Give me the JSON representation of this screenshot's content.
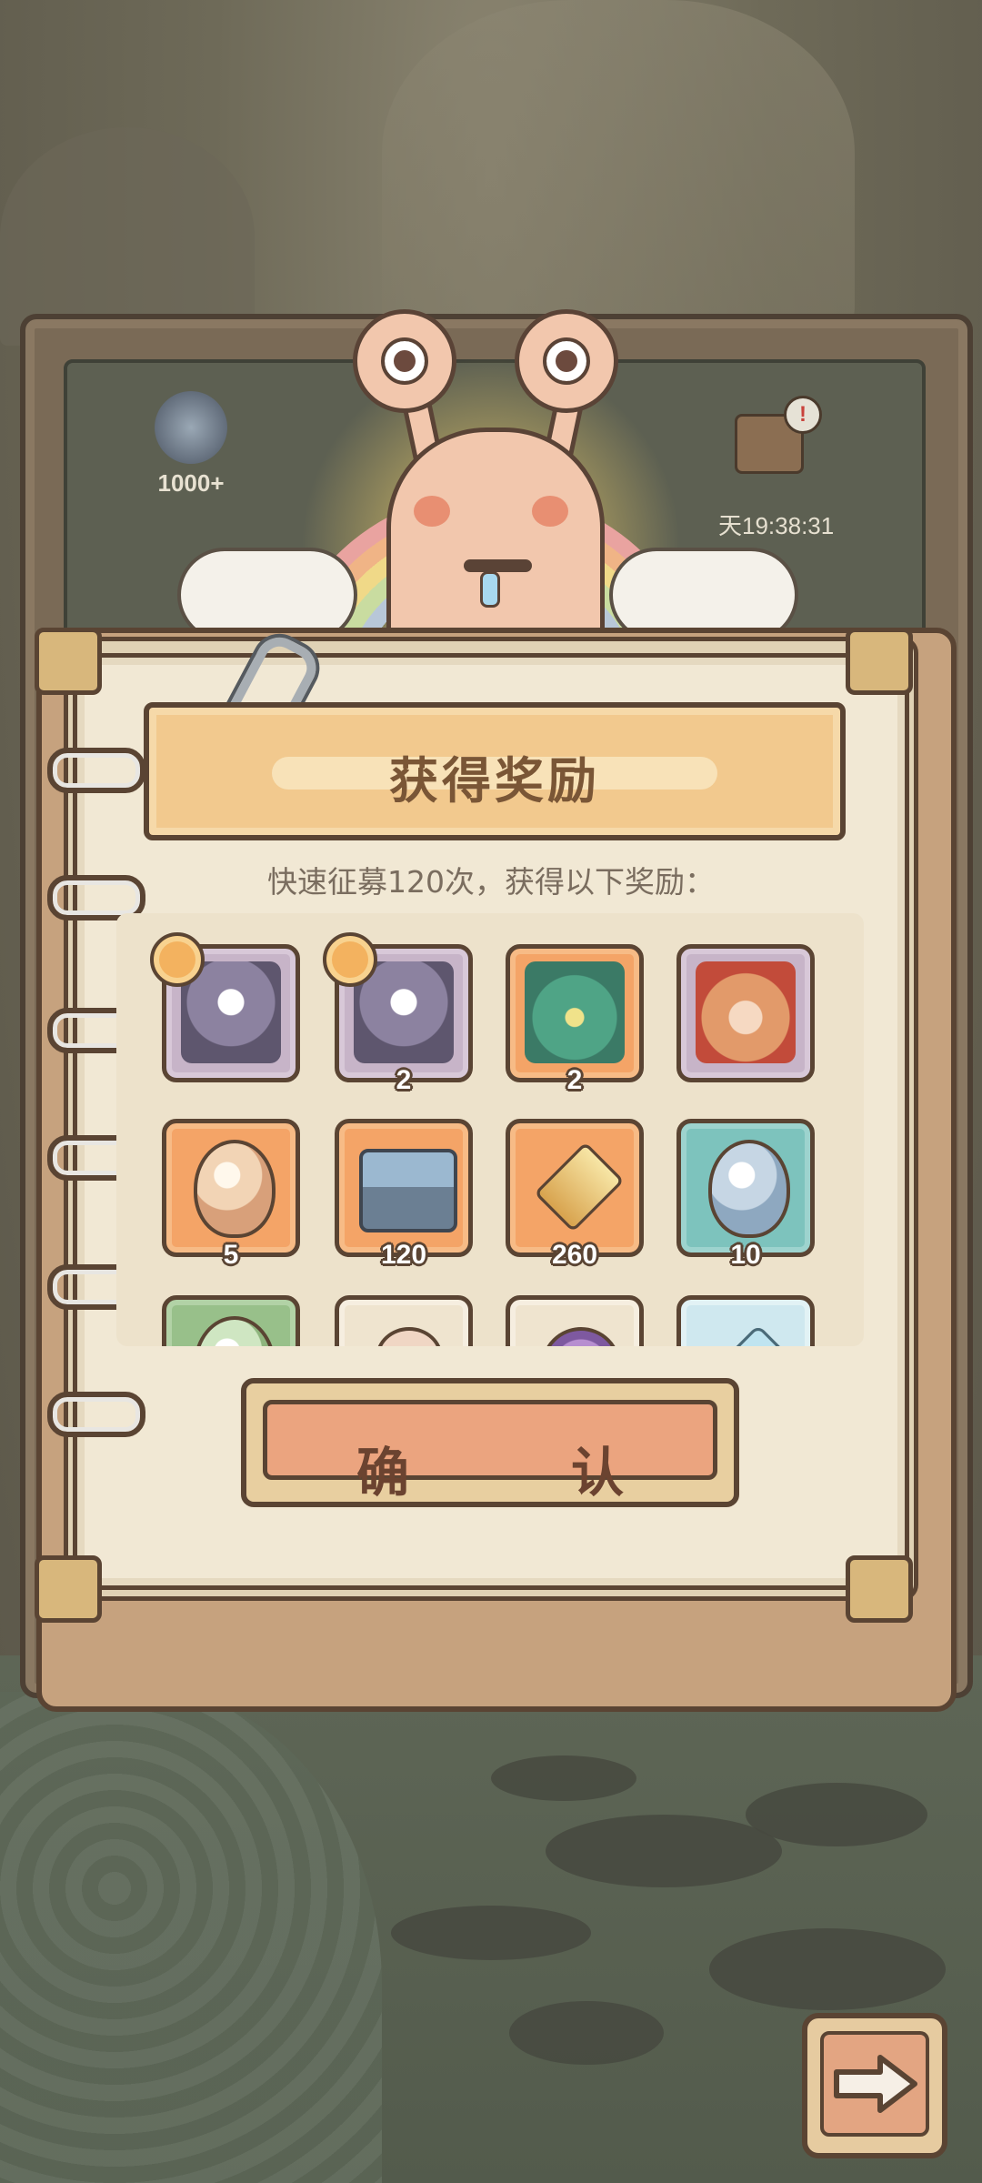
{
  "background": {
    "badge_value": "1000+",
    "timer": "天19:38:31",
    "alert_glyph": "!"
  },
  "dialog": {
    "title": "获得奖励",
    "subtitle": "快速征募120次，获得以下奖励：",
    "confirm_label": "确　认"
  },
  "rewards": [
    {
      "icon": "ghost-hero-icon",
      "count": "",
      "tier_badge": true
    },
    {
      "icon": "ghost-hero-icon",
      "count": "2",
      "tier_badge": true
    },
    {
      "icon": "dragon-hero-icon",
      "count": "2",
      "tier_badge": false
    },
    {
      "icon": "tiger-hero-icon",
      "count": "",
      "tier_badge": false
    },
    {
      "icon": "orange-egg-icon",
      "count": "5"
    },
    {
      "icon": "treasure-chest-icon",
      "count": "120"
    },
    {
      "icon": "medal-icon",
      "count": "260"
    },
    {
      "icon": "blue-egg-icon",
      "count": "10"
    },
    {
      "icon": "green-egg-icon",
      "count": ""
    },
    {
      "icon": "snail-icon",
      "count": ""
    },
    {
      "icon": "purple-shell-icon",
      "count": ""
    },
    {
      "icon": "crystal-icon",
      "count": ""
    }
  ],
  "colors": {
    "paper": "#f1e8d4",
    "banner": "#f2c98e",
    "confirm": "#eba47f",
    "outline": "#5a4433"
  }
}
